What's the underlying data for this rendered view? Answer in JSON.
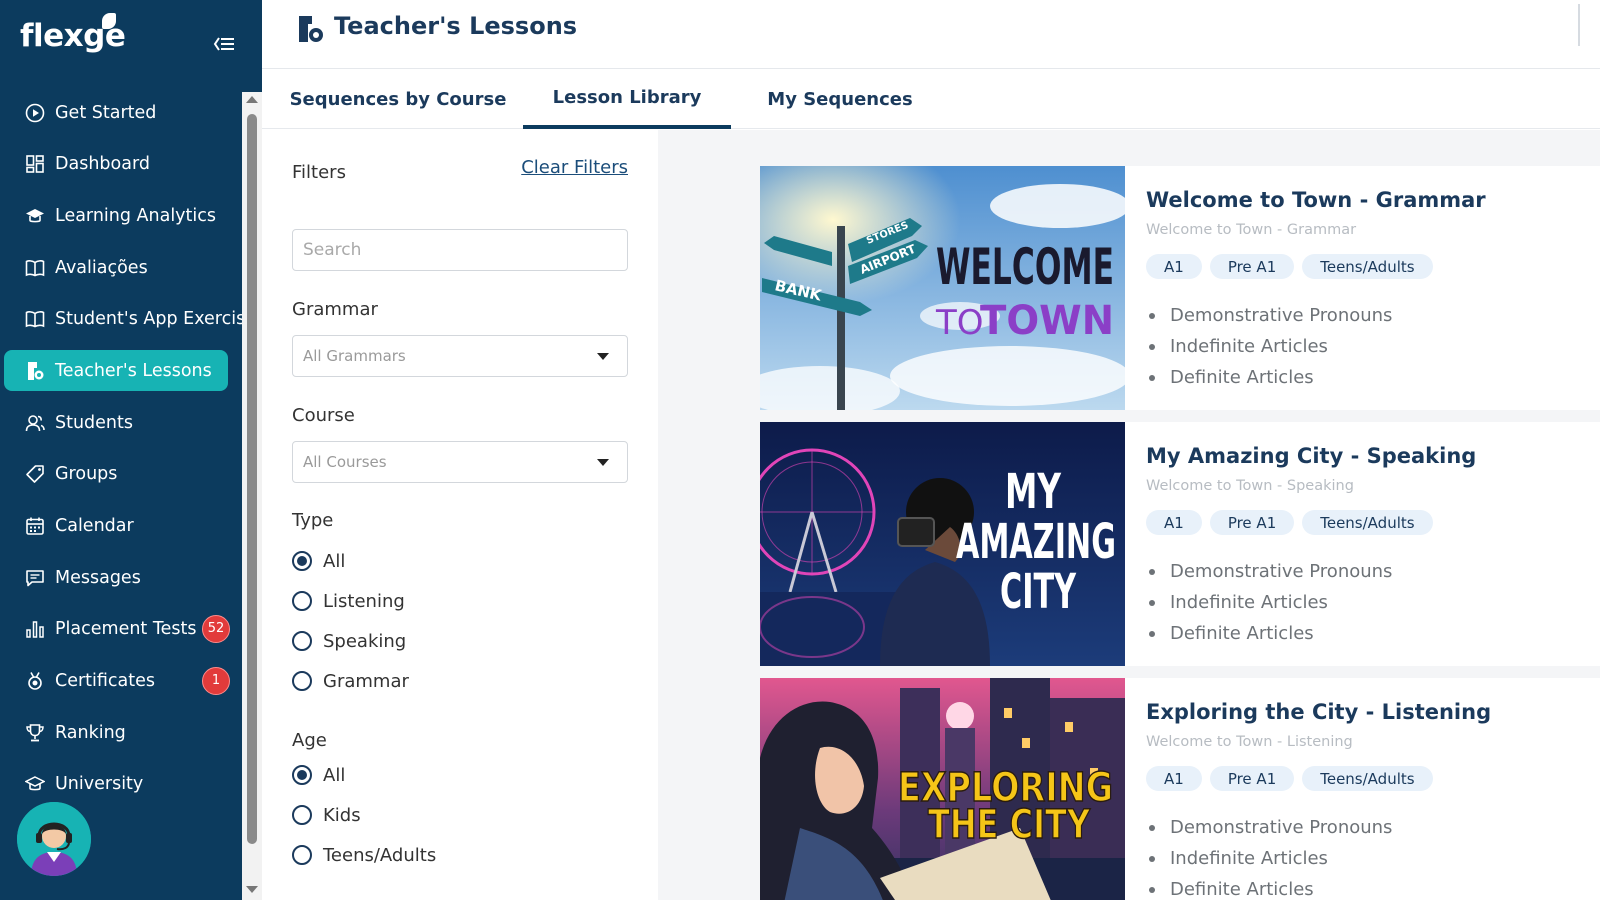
{
  "app": {
    "logo": "flexge"
  },
  "header": {
    "title": "Teacher's Lessons"
  },
  "sidebar": {
    "items": [
      {
        "label": "Get Started",
        "icon": "play-circle-icon",
        "active": false
      },
      {
        "label": "Dashboard",
        "icon": "dashboard-grid-icon",
        "active": false
      },
      {
        "label": "Learning Analytics",
        "icon": "graduation-cap-icon",
        "active": false
      },
      {
        "label": "Avaliações",
        "icon": "open-book-icon",
        "active": false
      },
      {
        "label": "Student's App Exercises",
        "icon": "open-book-icon",
        "active": false
      },
      {
        "label": "Teacher's Lessons",
        "icon": "lesson-icon",
        "active": true
      },
      {
        "label": "Students",
        "icon": "users-icon",
        "active": false
      },
      {
        "label": "Groups",
        "icon": "tag-icon",
        "active": false
      },
      {
        "label": "Calendar",
        "icon": "calendar-icon",
        "active": false
      },
      {
        "label": "Messages",
        "icon": "message-icon",
        "active": false
      },
      {
        "label": "Placement Tests",
        "icon": "bar-chart-icon",
        "active": false,
        "badge": "52"
      },
      {
        "label": "Certificates",
        "icon": "medal-icon",
        "active": false,
        "badge": "1"
      },
      {
        "label": "Ranking",
        "icon": "trophy-icon",
        "active": false
      },
      {
        "label": "University",
        "icon": "graduation-cap-icon",
        "active": false
      }
    ]
  },
  "tabs": [
    {
      "label": "Sequences by Course",
      "active": false
    },
    {
      "label": "Lesson Library",
      "active": true
    },
    {
      "label": "My Sequences",
      "active": false
    }
  ],
  "filters": {
    "title": "Filters",
    "clear_label": "Clear Filters",
    "search_placeholder": "Search",
    "grammar": {
      "label": "Grammar",
      "value": "All Grammars"
    },
    "course": {
      "label": "Course",
      "value": "All Courses"
    },
    "type": {
      "label": "Type",
      "options": [
        {
          "label": "All",
          "checked": true
        },
        {
          "label": "Listening",
          "checked": false
        },
        {
          "label": "Speaking",
          "checked": false
        },
        {
          "label": "Grammar",
          "checked": false
        }
      ]
    },
    "age": {
      "label": "Age",
      "options": [
        {
          "label": "All",
          "checked": true
        },
        {
          "label": "Kids",
          "checked": false
        },
        {
          "label": "Teens/Adults",
          "checked": false
        }
      ]
    }
  },
  "lessons": [
    {
      "title": "Welcome to Town - Grammar",
      "subtitle": "Welcome to Town - Grammar",
      "tags": [
        "A1",
        "Pre A1",
        "Teens/Adults"
      ],
      "topics": [
        "Demonstrative Pronouns",
        "Indefinite Articles",
        "Definite Articles"
      ],
      "image": {
        "line1": "WELCOME",
        "line2a": "TO ",
        "line2b": "TOWN",
        "signs": [
          "STORES",
          "AIRPORT",
          "BANK"
        ]
      }
    },
    {
      "title": "My Amazing City - Speaking",
      "subtitle": "Welcome to Town - Speaking",
      "tags": [
        "A1",
        "Pre A1",
        "Teens/Adults"
      ],
      "topics": [
        "Demonstrative Pronouns",
        "Indefinite Articles",
        "Definite Articles"
      ],
      "image": {
        "line1": "MY",
        "line2": "AMAZING",
        "line3": "CITY"
      }
    },
    {
      "title": "Exploring the City - Listening",
      "subtitle": "Welcome to Town - Listening",
      "tags": [
        "A1",
        "Pre A1",
        "Teens/Adults"
      ],
      "topics": [
        "Demonstrative Pronouns",
        "Indefinite Articles",
        "Definite Articles"
      ],
      "image": {
        "line1": "EXPLORING",
        "line2": "THE CITY"
      }
    }
  ],
  "colors": {
    "sidebar_bg": "#0c3b5e",
    "active_item": "#17b3b4",
    "badge": "#e23b3b",
    "title_text": "#1b3a5c",
    "pill_bg": "#e8f1fa",
    "content_bg": "#f4f5f7"
  }
}
